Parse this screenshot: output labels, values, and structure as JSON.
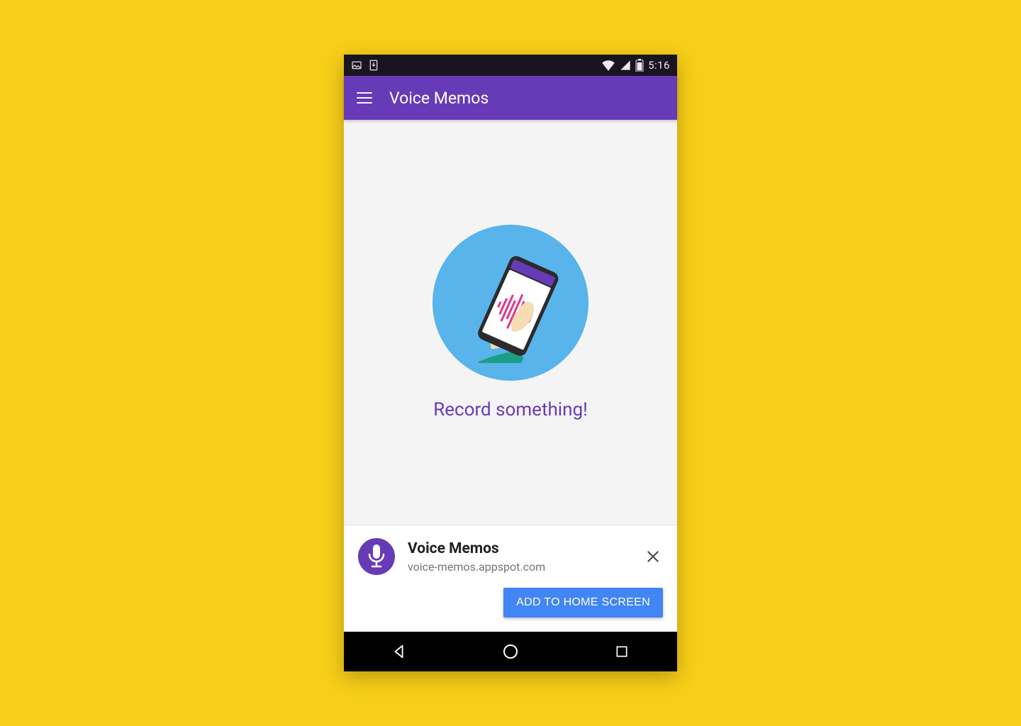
{
  "statusbar": {
    "time": "5:16",
    "icons": {
      "image": "image-notification-icon",
      "download": "download-notification-icon",
      "wifi": "wifi-icon",
      "signal": "cell-signal-icon",
      "battery": "battery-icon"
    }
  },
  "appbar": {
    "title": "Voice Memos",
    "menu_icon": "hamburger-icon"
  },
  "content": {
    "prompt": "Record something!"
  },
  "install_banner": {
    "app_name": "Voice Memos",
    "host": "voice-memos.appspot.com",
    "action_label": "ADD TO HOME SCREEN",
    "close_icon": "close-icon",
    "app_icon": "microphone-icon"
  },
  "navbar": {
    "back": "back-icon",
    "home": "home-icon",
    "recents": "recents-icon"
  },
  "colors": {
    "accent": "#673ab7",
    "button": "#4285f4",
    "page_bg": "#f7ce18"
  }
}
